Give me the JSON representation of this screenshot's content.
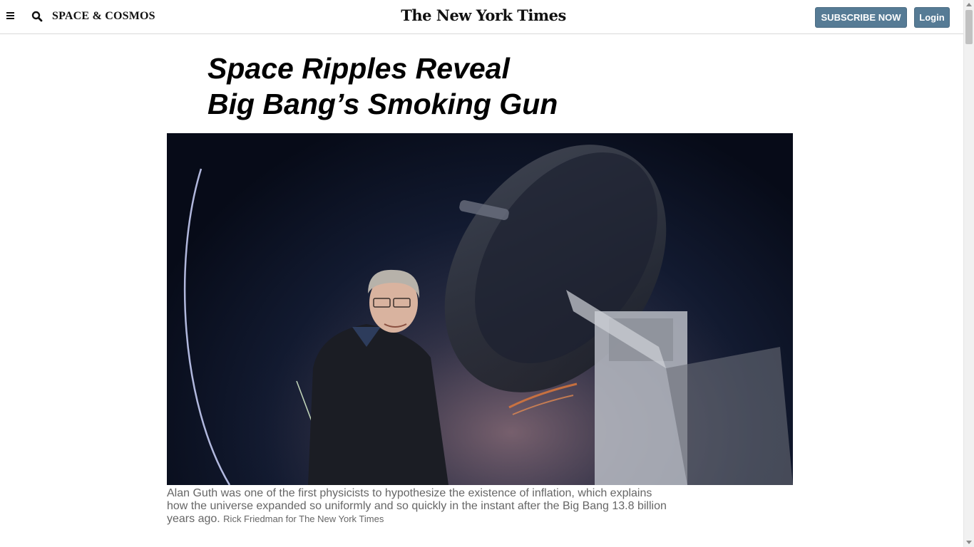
{
  "header": {
    "section": "SPACE & COSMOS",
    "masthead": "The New York Times",
    "subscribe_label": "SUBSCRIBE NOW",
    "login_label": "Login"
  },
  "article": {
    "headline_line1": "Space Ripples Reveal",
    "headline_line2": "Big Bang’s Smoking Gun",
    "photo_alt": "Alan Guth standing in front of a telescope at night",
    "caption": "Alan Guth was one of the first physicists to hypothesize the existence of inflation, which explains how the universe expanded so uniformly and so quickly in the instant after the Big Bang 13.8 billion years ago.",
    "credit": "Rick Friedman for The New York Times"
  },
  "colors": {
    "button_bg": "#567b95",
    "caption_text": "#666666"
  }
}
